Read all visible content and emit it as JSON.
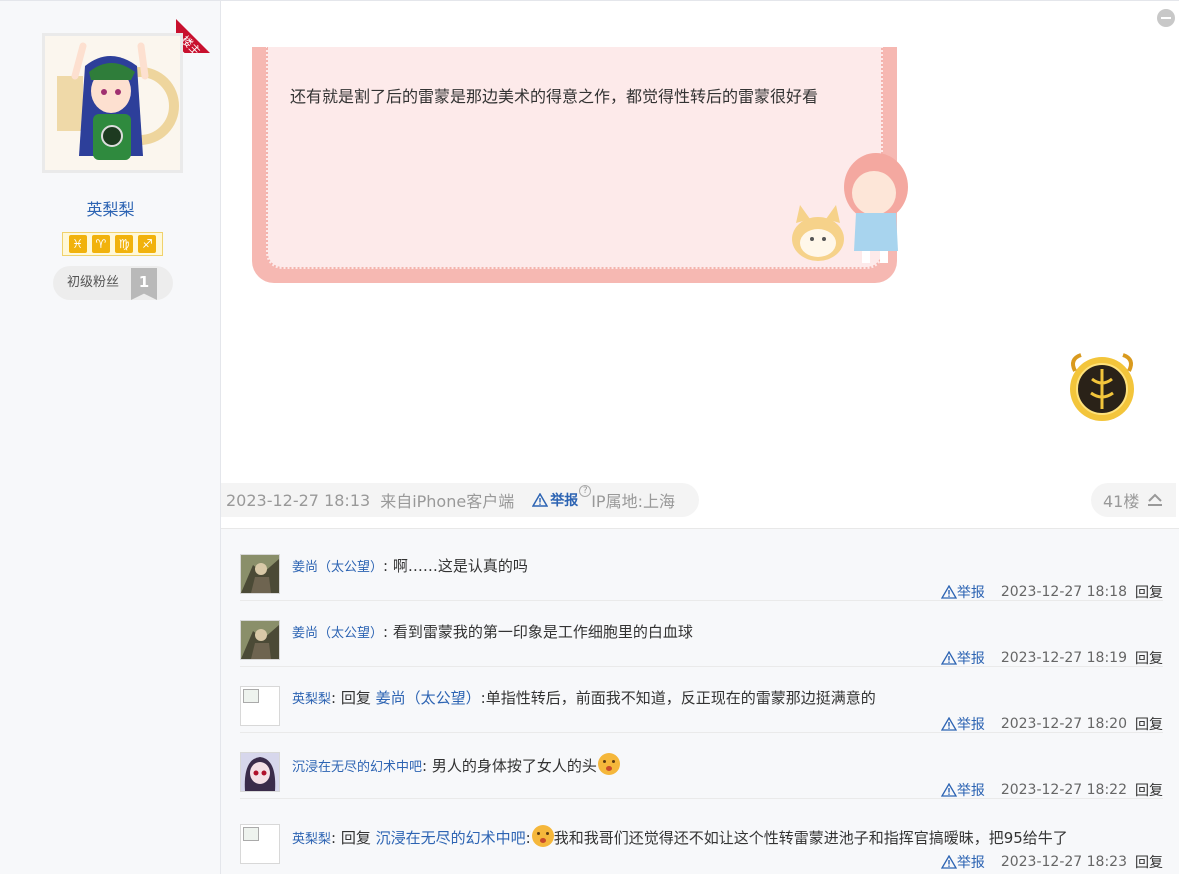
{
  "author": {
    "badge": "楼主",
    "name": "英梨梨",
    "sign_icons": [
      "♓",
      "♈",
      "♍",
      "♐"
    ],
    "fan_level_label": "初级粉丝",
    "fan_level_num": "1"
  },
  "post": {
    "text": "还有就是割了后的雷蒙是那边美术的得意之作，都觉得性转后的雷蒙很好看",
    "time": "2023-12-27 18:13",
    "source": "来自iPhone客户端",
    "report_label": "举报",
    "help_mark": "?",
    "ip_location": "IP属地:上海",
    "floor": "41楼"
  },
  "replies": [
    {
      "user": "姜尚（太公望）",
      "sep": ":",
      "prefix": "",
      "ref_user": "",
      "ref_sep": "",
      "text": "啊……这是认真的吗",
      "report": "举报",
      "time": "2023-12-27 18:18",
      "action": "回复"
    },
    {
      "user": "姜尚（太公望）",
      "sep": ":",
      "prefix": "",
      "ref_user": "",
      "ref_sep": "",
      "text": "看到雷蒙我的第一印象是工作细胞里的白血球",
      "report": "举报",
      "time": "2023-12-27 18:19",
      "action": "回复"
    },
    {
      "user": "英梨梨",
      "sep": ":",
      "prefix": "回复",
      "ref_user": "姜尚（太公望）",
      "ref_sep": ":",
      "text": "单指性转后，前面我不知道，反正现在的雷蒙那边挺满意的",
      "report": "举报",
      "time": "2023-12-27 18:20",
      "action": "回复"
    },
    {
      "user": "沉浸在无尽的幻术中吧",
      "sep": ":",
      "prefix": "",
      "ref_user": "",
      "ref_sep": "",
      "text": "男人的身体按了女人的头",
      "report": "举报",
      "time": "2023-12-27 18:22",
      "action": "回复"
    },
    {
      "user": "英梨梨",
      "sep": ":",
      "prefix": "回复",
      "ref_user": "沉浸在无尽的幻术中吧",
      "ref_sep": ":",
      "text": "我和我哥们还觉得还不如让这个性转雷蒙进池子和指挥官搞暧昧，把95给牛了",
      "report": "举报",
      "time": "2023-12-27 18:23",
      "action": "回复"
    }
  ],
  "colors": {
    "link": "#2d64b3",
    "badge": "#c8102e",
    "bubble_border": "#f6b8b2",
    "bubble_fill": "#fdeaea"
  }
}
